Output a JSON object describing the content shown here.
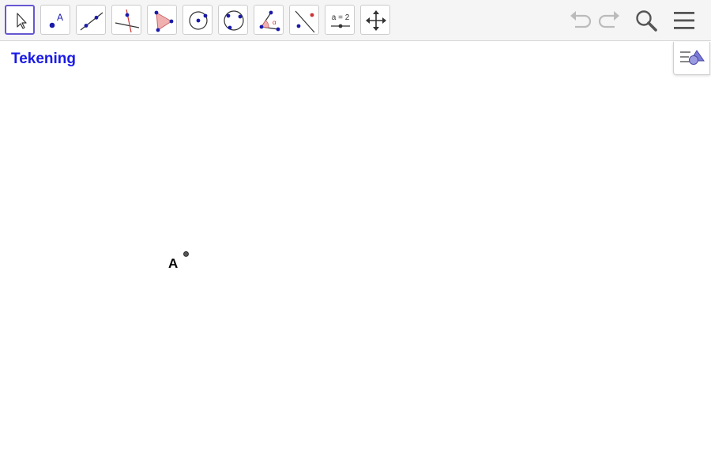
{
  "toolbar": {
    "tools": [
      {
        "id": "move",
        "icon": "pointer-arrow-icon",
        "active": true
      },
      {
        "id": "point",
        "icon": "point-icon",
        "label": "A"
      },
      {
        "id": "line",
        "icon": "line-through-points-icon"
      },
      {
        "id": "perpendicular",
        "icon": "perpendicular-line-icon"
      },
      {
        "id": "polygon",
        "icon": "polygon-icon"
      },
      {
        "id": "circle",
        "icon": "circle-center-point-icon"
      },
      {
        "id": "circle-three-points",
        "icon": "circle-three-points-icon"
      },
      {
        "id": "angle",
        "icon": "angle-icon",
        "label": "α"
      },
      {
        "id": "reflect",
        "icon": "reflect-about-line-icon"
      },
      {
        "id": "slider",
        "icon": "slider-icon",
        "label": "a = 2"
      },
      {
        "id": "move-view",
        "icon": "move-graphics-view-icon"
      }
    ],
    "undo_icon": "undo-icon",
    "redo_icon": "redo-icon",
    "search_icon": "search-icon",
    "menu_icon": "hamburger-menu-icon"
  },
  "view": {
    "title": "Tekening",
    "style_bar_icon": "style-bar-toggle-icon"
  },
  "objects": [
    {
      "label": "A",
      "type": "point",
      "color": "#333333"
    }
  ],
  "colors": {
    "accent": "#6557d2",
    "title": "#1a1ae6",
    "tool_blue": "#1a1aaa",
    "tool_red": "#cc3333",
    "polygon_fill": "#f0b0b0"
  }
}
